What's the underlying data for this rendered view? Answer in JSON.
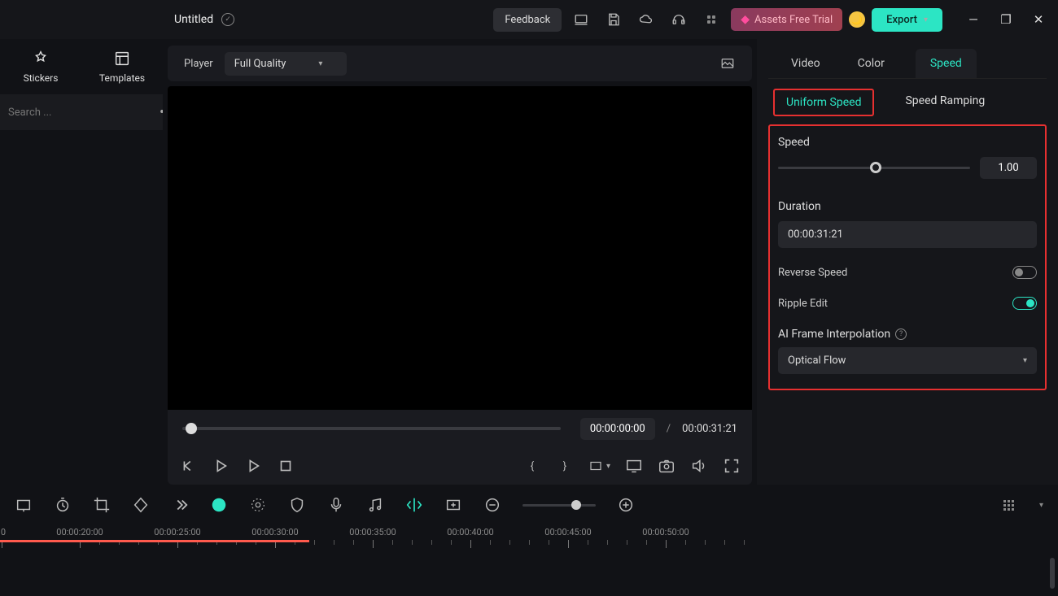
{
  "topbar": {
    "title": "Untitled",
    "feedback": "Feedback",
    "trial": "Assets Free Trial",
    "export": "Export"
  },
  "sidebar": {
    "tabs": {
      "stickers": "Stickers",
      "templates": "Templates"
    },
    "search_placeholder": "Search ..."
  },
  "player": {
    "label": "Player",
    "quality": "Full Quality",
    "current": "00:00:00:00",
    "sep": "/",
    "duration": "00:00:31:21"
  },
  "panel": {
    "tabs1": {
      "video": "Video",
      "color": "Color",
      "speed": "Speed"
    },
    "tabs2": {
      "uniform": "Uniform Speed",
      "ramping": "Speed Ramping"
    },
    "speed_label": "Speed",
    "speed_value": "1.00",
    "duration_label": "Duration",
    "duration_value": "00:00:31:21",
    "reverse": "Reverse Speed",
    "ripple": "Ripple Edit",
    "ai_label": "AI Frame Interpolation",
    "ai_value": "Optical Flow"
  },
  "timeline": {
    "labels": [
      "00:00:20:00",
      "00:00:25:00",
      "00:00:30:00",
      "00:00:35:00",
      "00:00:40:00",
      "00:00:45:00",
      "00:00:50:00"
    ]
  }
}
